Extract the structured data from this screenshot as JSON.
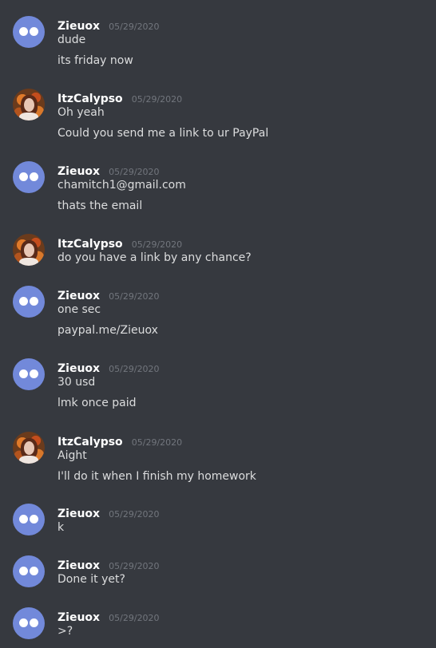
{
  "messages": [
    {
      "author": "Zieuox",
      "avatar": "default-blurple-icon",
      "timestamp": "05/29/2020",
      "lines": [
        "dude",
        "its friday now"
      ]
    },
    {
      "author": "ItzCalypso",
      "avatar": "photo-avatar",
      "timestamp": "05/29/2020",
      "lines": [
        "Oh yeah",
        "Could you send me a link to ur PayPal"
      ]
    },
    {
      "author": "Zieuox",
      "avatar": "default-blurple-icon",
      "timestamp": "05/29/2020",
      "lines": [
        "chamitch1@gmail.com",
        "thats the email"
      ]
    },
    {
      "author": "ItzCalypso",
      "avatar": "photo-avatar",
      "timestamp": "05/29/2020",
      "lines": [
        "do you have a link by any chance?"
      ]
    },
    {
      "author": "Zieuox",
      "avatar": "default-blurple-icon",
      "timestamp": "05/29/2020",
      "lines": [
        "one sec",
        "paypal.me/Zieuox"
      ]
    },
    {
      "author": "Zieuox",
      "avatar": "default-blurple-icon",
      "timestamp": "05/29/2020",
      "lines": [
        "30 usd",
        "lmk once paid"
      ]
    },
    {
      "author": "ItzCalypso",
      "avatar": "photo-avatar",
      "timestamp": "05/29/2020",
      "lines": [
        "Aight",
        "I'll do it when I finish my homework"
      ]
    },
    {
      "author": "Zieuox",
      "avatar": "default-blurple-icon",
      "timestamp": "05/29/2020",
      "lines": [
        "k"
      ]
    },
    {
      "author": "Zieuox",
      "avatar": "default-blurple-icon",
      "timestamp": "05/29/2020",
      "lines": [
        "Done it yet?"
      ]
    },
    {
      "author": "Zieuox",
      "avatar": "default-blurple-icon",
      "timestamp": "05/29/2020",
      "lines": [
        ">?"
      ]
    }
  ],
  "colors": {
    "background": "#36393f",
    "username": "#ffffff",
    "timestamp": "#72767d",
    "message_text": "#dcddde",
    "default_avatar": "#7289da"
  }
}
